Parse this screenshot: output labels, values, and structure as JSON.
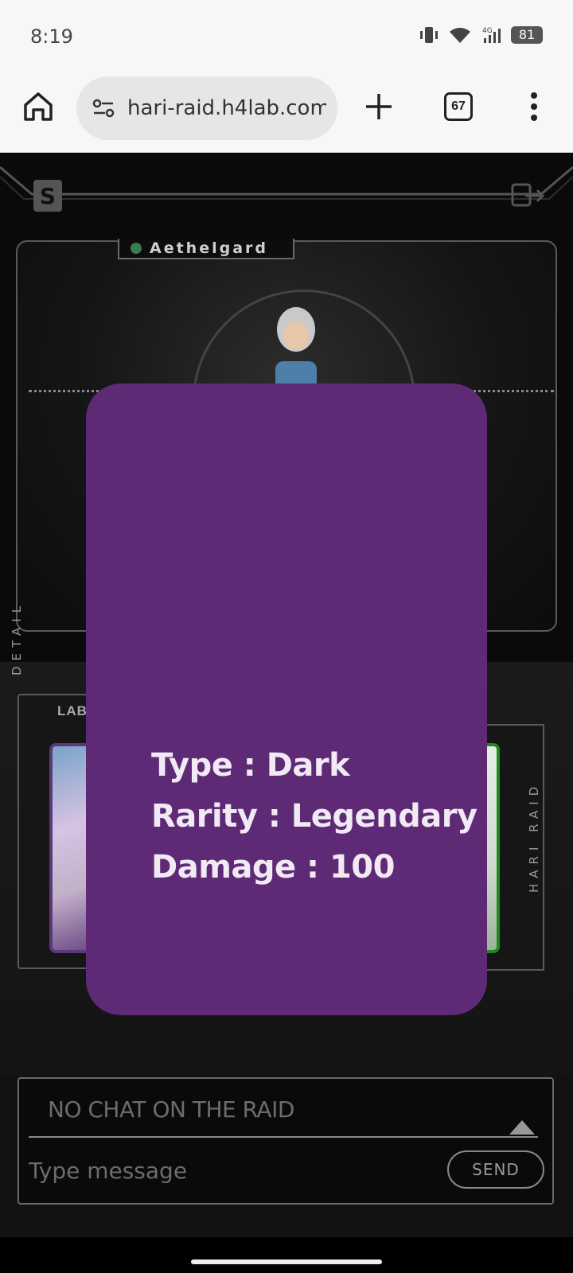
{
  "status_bar": {
    "time": "8:19",
    "battery": "81",
    "network": "4G"
  },
  "browser": {
    "url": "hari-raid.h4lab.com/",
    "tab_count": "67"
  },
  "game": {
    "region": "Aethelgard",
    "side_left_label": "DETAIL",
    "side_right_label": "HARI RAID",
    "left_panel_label": "LAB"
  },
  "card_modal": {
    "type_line": "Type : Dark",
    "rarity_line": "Rarity : Legendary",
    "damage_line": "Damage : 100",
    "color": "#5e2975"
  },
  "chat": {
    "empty_message": "NO CHAT ON THE RAID",
    "input_placeholder": "Type message",
    "send_label": "SEND"
  },
  "icons": [
    "home-icon",
    "tune-icon",
    "plus-icon",
    "tabs-icon",
    "kebab-menu-icon",
    "s-logo-icon",
    "logout-icon",
    "vibrate-icon",
    "wifi-icon",
    "signal-icon",
    "battery-icon"
  ]
}
